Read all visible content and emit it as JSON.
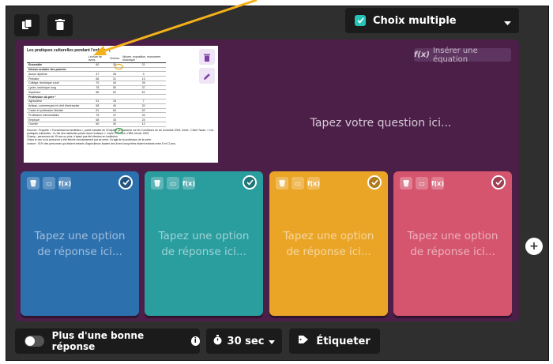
{
  "colors": {
    "frame": "#2f2f2f",
    "question_area": "#4b1f48",
    "option_1": "#2d70ae",
    "option_2": "#2a9d9f",
    "option_3": "#eaa527",
    "option_4": "#d5546e",
    "accent_check": "#27c3b6",
    "annotation_arrow": "#f5b11a"
  },
  "toolbar": {
    "copy_icon": "copy-icon",
    "delete_icon": "trash-icon",
    "question_type": "Choix multiple"
  },
  "question": {
    "insert_equation_label": "Insérer une équation",
    "placeholder": "Tapez votre question ici..."
  },
  "image_doc": {
    "title": "Les pratiques culturelles pendant l'enfance (",
    "headers": [
      "",
      "Lecture de livres",
      "Cinéma",
      "Musée, exposition, monument historique"
    ],
    "rows": [
      {
        "label": "Ensemble",
        "bold": true,
        "v1": "60",
        "v2": "36",
        "v3": "21"
      },
      {
        "label": "Niveau scolaire des parents",
        "bold": true,
        "v1": "",
        "v2": "",
        "v3": ""
      },
      {
        "label": "Aucun diplôme",
        "bold": false,
        "v1": "47",
        "v2": "28",
        "v3": "9"
      },
      {
        "label": "Primaire",
        "bold": false,
        "v1": "66",
        "v2": "31",
        "v3": "13"
      },
      {
        "label": "Collège, technique court",
        "bold": false,
        "v1": "70",
        "v2": "40",
        "v3": "26"
      },
      {
        "label": "Lycée, technique long",
        "bold": false,
        "v1": "78",
        "v2": "50",
        "v3": "37"
      },
      {
        "label": "Supérieur",
        "bold": false,
        "v1": "86",
        "v2": "62",
        "v3": "61"
      },
      {
        "label": "Profession du père ¹",
        "bold": true,
        "v1": "",
        "v2": "",
        "v3": ""
      },
      {
        "label": "Agriculteur",
        "bold": false,
        "v1": "51",
        "v2": "15",
        "v3": "7"
      },
      {
        "label": "Artisan, commerçant et chef d'entreprise",
        "bold": false,
        "v1": "58",
        "v2": "40",
        "v3": "20"
      },
      {
        "label": "Cadre et profession libérale",
        "bold": false,
        "v1": "81",
        "v2": "64",
        "v3": "52"
      },
      {
        "label": "Profession intermédiaire",
        "bold": false,
        "v1": "76",
        "v2": "47",
        "v3": "34"
      },
      {
        "label": "Employé",
        "bold": false,
        "v1": "68",
        "v2": "43",
        "v3": "24"
      },
      {
        "label": "Ouvrier",
        "bold": false,
        "v1": "50",
        "v2": "30",
        "v3": "12"
      }
    ],
    "sources": "Sources : Enquête « Transmissions familiales », partie variable de l'Enquête permanente sur les Conditions de vie d'octobre 2003, Insee ; Chloé Tavan, « Les pratiques culturelles : le rôle des habitudes prises dans l'enfance », Insee Première n°883, février 2003.",
    "champ": "Champ : personnes de 15 ans ou plus, n'ayant pas été élevées en institution.",
    "note": "¹Dans le cas où la personne a été élevée exclusivement par sa mère, il s'agit de la profession de la mère.",
    "lecture": "Lecture : 51% des personnes qui étaient enfants d'agriculteurs lisaient des livres lorsqu'elles étaient enfants entre 8 et 12 ans."
  },
  "options": [
    {
      "placeholder": "Tapez une option de réponse ici...",
      "equation_label": "f(x)"
    },
    {
      "placeholder": "Tapez une option de réponse ici...",
      "equation_label": "f(x)"
    },
    {
      "placeholder": "Tapez une option de réponse ici...",
      "equation_label": "f(x)"
    },
    {
      "placeholder": "Tapez une option de réponse ici...",
      "equation_label": "f(x)"
    }
  ],
  "footer": {
    "multi_answer_label": "Plus d'une bonne réponse",
    "time_label": "30 sec",
    "tag_label": "Étiqueter"
  }
}
